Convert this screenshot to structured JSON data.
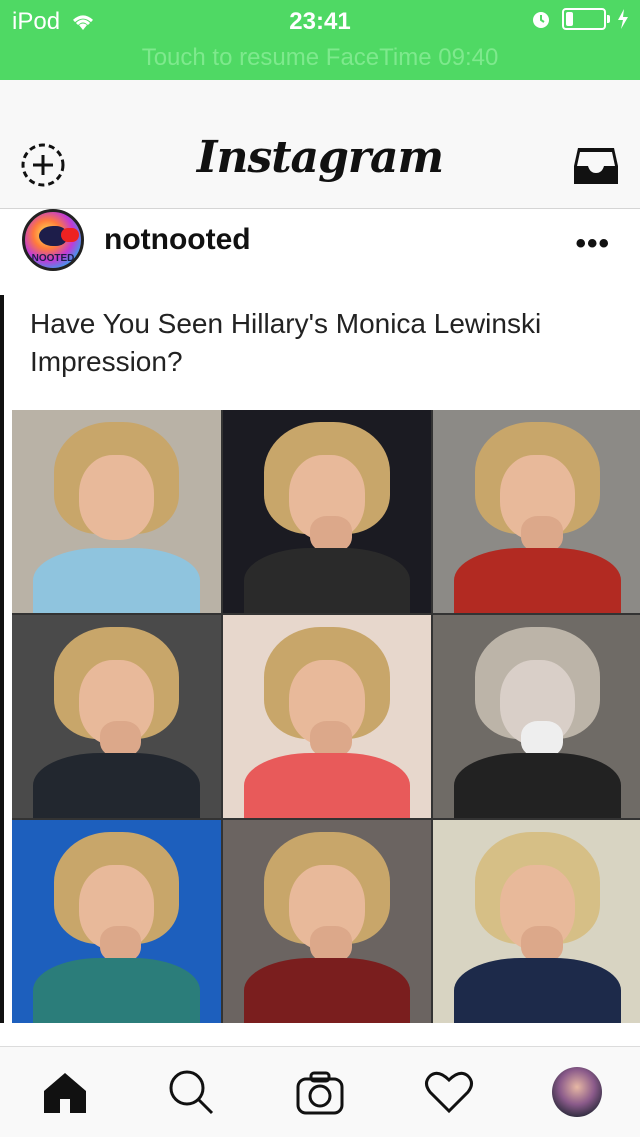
{
  "status_bar": {
    "carrier": "iPod",
    "time": "23:41",
    "resume_banner": "Touch to resume FaceTime  09:40",
    "battery_level": 0.2
  },
  "nav": {
    "logo": "Instagram",
    "left_icon": "add-person-icon",
    "right_icon": "inbox-icon"
  },
  "post": {
    "username": "notnooted",
    "avatar_text": "NOOTED",
    "more_label": "•••",
    "image_caption": "Have You Seen Hillary's Monica Lewinski Impression?"
  },
  "tabbar": {
    "icons": [
      "home-icon",
      "search-icon",
      "camera-icon",
      "heart-icon",
      "profile-avatar"
    ]
  },
  "colors": {
    "status_green": "#4fd964",
    "nav_bg": "#f8f8f8"
  }
}
